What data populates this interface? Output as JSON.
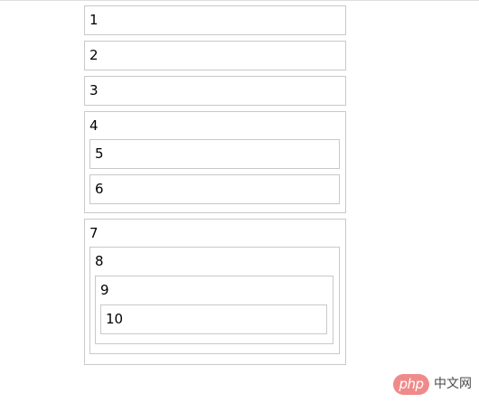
{
  "boxes": {
    "b1": "1",
    "b2": "2",
    "b3": "3",
    "b4": "4",
    "b5": "5",
    "b6": "6",
    "b7": "7",
    "b8": "8",
    "b9": "9",
    "b10": "10"
  },
  "watermark": {
    "pill_text": "php",
    "site_text": "中文网"
  }
}
